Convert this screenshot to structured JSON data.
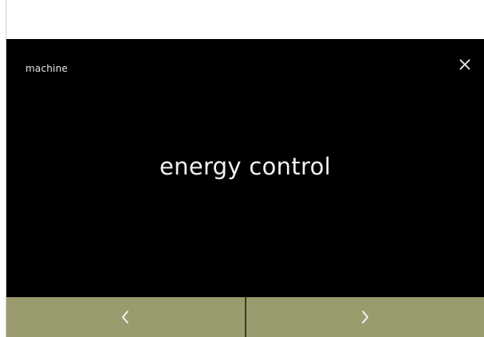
{
  "header": {
    "breadcrumb": "machine",
    "close_icon": "close-icon"
  },
  "main": {
    "title": "energy control"
  },
  "navigation": {
    "prev_icon": "chevron-left-icon",
    "next_icon": "chevron-right-icon"
  },
  "colors": {
    "screen_background": "#000000",
    "nav_bar_background": "#9b9c6d",
    "text": "#f2f2f2",
    "page_background": "#ffffff"
  }
}
